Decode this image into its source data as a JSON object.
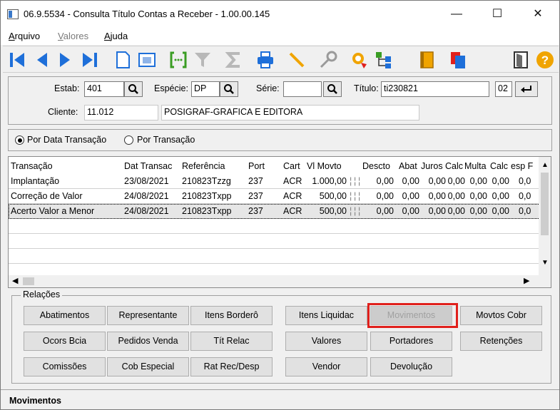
{
  "window": {
    "title": "06.9.5534 - Consulta Título Contas a Receber - 1.00.00.145",
    "minimize": "—",
    "maximize": "☐",
    "close": "✕"
  },
  "menu": [
    {
      "label": "Arquivo",
      "accel": "A",
      "rest": "rquivo"
    },
    {
      "label": "Valores",
      "accel": "V",
      "rest": "alores"
    },
    {
      "label": "Ajuda",
      "accel": "A",
      "rest": "juda"
    }
  ],
  "toolbar": {
    "icons": [
      "first-record-icon",
      "previous-record-icon",
      "next-record-icon",
      "last-record-icon",
      "new-document-icon",
      "preview-icon",
      "goto-icon",
      "filter-icon",
      "sum-icon",
      "print-icon",
      "pencil-icon",
      "search-key-icon",
      "zoom-icon",
      "tree-icon",
      "book-icon",
      "copy-icon",
      "exit-door-icon",
      "help-icon"
    ],
    "colors": {
      "blue": "#1e6fd9",
      "yellow": "#f0a400",
      "green": "#3a9d23"
    }
  },
  "header": {
    "estab_label": "Estab:",
    "estab_value": "401",
    "especie_label": "Espécie:",
    "especie_value": "DP",
    "serie_label": "Série:",
    "serie_value": "",
    "titulo_label": "Título:",
    "titulo_value": "ti230821",
    "parcela_value": "02",
    "cliente_label": "Cliente:",
    "cliente_code": "11.012",
    "cliente_name": "POSIGRAF-GRAFICA E EDITORA"
  },
  "radio": {
    "option1": "Por Data Transação",
    "option2": "Por Transação",
    "selected": "option1"
  },
  "grid": {
    "columns": [
      "Transação",
      "Dat Transac",
      "Referência",
      "Port",
      "Cart",
      "Vl Movto",
      "",
      "",
      "Descto",
      "Abat",
      "Juros",
      "Calc",
      "Multa",
      "Calc",
      "esp F"
    ],
    "rows": [
      {
        "transacao": "Implantação",
        "data": "23/08/2021",
        "referencia": "210823Tzzg",
        "port": "237",
        "cart": "ACR",
        "vlmovto": "1.000,00",
        "descto": "0,00",
        "abat": "0,00",
        "juros": "0,00",
        "calc1": "0,00",
        "multa": "0,00",
        "calc2": "0,00",
        "esp": "0,0"
      },
      {
        "transacao": "Correção de Valor",
        "data": "24/08/2021",
        "referencia": "210823Txpp",
        "port": "237",
        "cart": "ACR",
        "vlmovto": "500,00",
        "descto": "0,00",
        "abat": "0,00",
        "juros": "0,00",
        "calc1": "0,00",
        "multa": "0,00",
        "calc2": "0,00",
        "esp": "0,0"
      },
      {
        "transacao": "Acerto Valor a Menor",
        "data": "24/08/2021",
        "referencia": "210823Txpp",
        "port": "237",
        "cart": "ACR",
        "vlmovto": "500,00",
        "descto": "0,00",
        "abat": "0,00",
        "juros": "0,00",
        "calc1": "0,00",
        "multa": "0,00",
        "calc2": "0,00",
        "esp": "0,0"
      }
    ],
    "selected_row": 2
  },
  "relacoes": {
    "label": "Relações",
    "buttons": [
      [
        "Abatimentos",
        "Representante",
        "Itens Borderô",
        "Itens Liquidac",
        "Movimentos",
        "Movtos Cobr"
      ],
      [
        "Ocors Bcia",
        "Pedidos Venda",
        "Tít Relac",
        "Valores",
        "Portadores",
        "Retenções"
      ],
      [
        "Comissões",
        "Cob Especial",
        "Rat Rec/Desp",
        "Vendor",
        "Devolução"
      ]
    ],
    "disabled": "Movimentos",
    "highlight_color": "#e0201c"
  },
  "status": {
    "text": "Movimentos"
  }
}
